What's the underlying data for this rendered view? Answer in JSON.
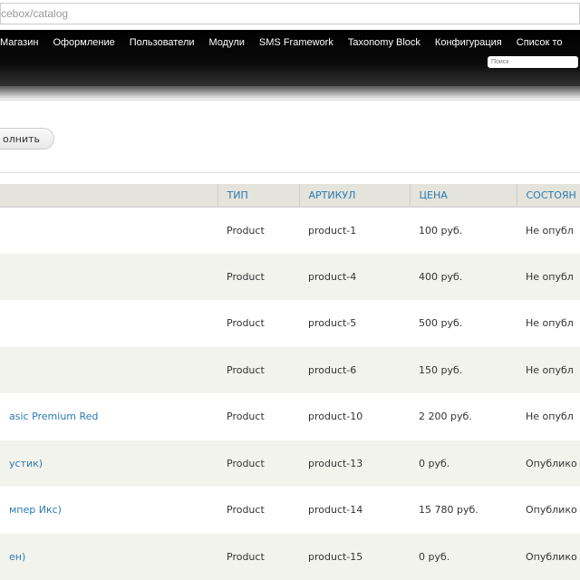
{
  "address_bar": {
    "url": "cebox/catalog"
  },
  "nav": {
    "items": [
      "Магазин",
      "Оформление",
      "Пользователи",
      "Модули",
      "SMS Framework",
      "Taxonomy Block",
      "Конфигурация",
      "Список то"
    ],
    "search_placeholder": "Поиск"
  },
  "execute_button": "олнить",
  "table": {
    "headers": [
      "",
      "ТИП",
      "АРТИКУЛ",
      "ЦЕНА",
      "СОСТОЯН"
    ],
    "rows": [
      {
        "title": "",
        "type": "Product",
        "sku": "product-1",
        "price": "100 руб.",
        "status": "Не опубл"
      },
      {
        "title": "",
        "type": "Product",
        "sku": "product-4",
        "price": "400 руб.",
        "status": "Не опубл"
      },
      {
        "title": "",
        "type": "Product",
        "sku": "product-5",
        "price": "500 руб.",
        "status": "Не опубл"
      },
      {
        "title": "",
        "type": "Product",
        "sku": "product-6",
        "price": "150 руб.",
        "status": "Не опубл"
      },
      {
        "title": "asic Premium Red",
        "type": "Product",
        "sku": "product-10",
        "price": "2 200 руб.",
        "status": "Не опубл"
      },
      {
        "title": "устик)",
        "type": "Product",
        "sku": "product-13",
        "price": "0 руб.",
        "status": "Опублико"
      },
      {
        "title": "мпер Икс)",
        "type": "Product",
        "sku": "product-14",
        "price": "15 780 руб.",
        "status": "Опублико"
      },
      {
        "title": "ен)",
        "type": "Product",
        "sku": "product-15",
        "price": "0 руб.",
        "status": "Опублико"
      }
    ]
  }
}
